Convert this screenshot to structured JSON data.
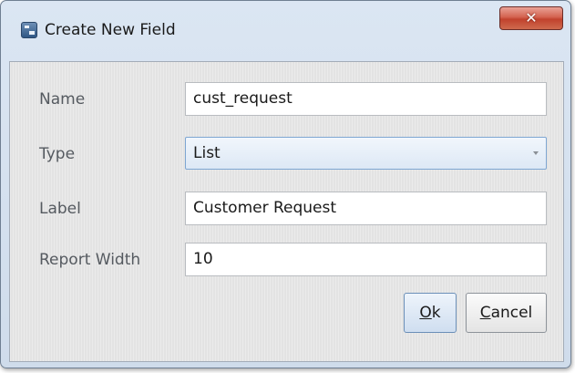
{
  "window": {
    "title": "Create New Field",
    "close_label": "✕"
  },
  "form": {
    "name": {
      "label": "Name",
      "value": "cust_request"
    },
    "type": {
      "label": "Type",
      "value": "List"
    },
    "label": {
      "label": "Label",
      "value": "Customer Request"
    },
    "report_width": {
      "label": "Report Width",
      "value": "10"
    }
  },
  "buttons": {
    "ok": {
      "label": "Ok",
      "mnemonic": "O",
      "rest": "k"
    },
    "cancel": {
      "label": "Cancel",
      "mnemonic": "C",
      "rest": "ancel"
    }
  }
}
